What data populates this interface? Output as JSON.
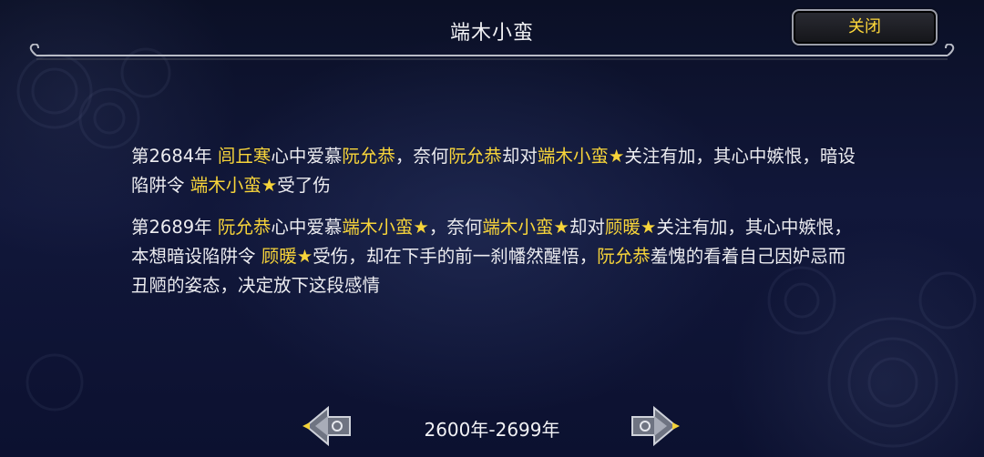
{
  "header": {
    "title": "端木小蛮",
    "close_label": "关闭"
  },
  "events": [
    {
      "segments": [
        {
          "text": "第2684年 ",
          "hl": false
        },
        {
          "text": "闾丘寒",
          "hl": true
        },
        {
          "text": "心中爱慕",
          "hl": false
        },
        {
          "text": "阮允恭",
          "hl": true
        },
        {
          "text": "，奈何",
          "hl": false
        },
        {
          "text": "阮允恭",
          "hl": true
        },
        {
          "text": "却对",
          "hl": false
        },
        {
          "text": "端木小蛮★",
          "hl": true
        },
        {
          "text": "关注有加，其心中嫉恨，暗设陷阱令 ",
          "hl": false
        },
        {
          "text": "端木小蛮★",
          "hl": true
        },
        {
          "text": "受了伤",
          "hl": false
        }
      ]
    },
    {
      "segments": [
        {
          "text": "第2689年 ",
          "hl": false
        },
        {
          "text": "阮允恭",
          "hl": true
        },
        {
          "text": "心中爱慕",
          "hl": false
        },
        {
          "text": "端木小蛮★",
          "hl": true
        },
        {
          "text": "，奈何",
          "hl": false
        },
        {
          "text": "端木小蛮★",
          "hl": true
        },
        {
          "text": "却对",
          "hl": false
        },
        {
          "text": "顾暖★",
          "hl": true
        },
        {
          "text": "关注有加，其心中嫉恨，本想暗设陷阱令 ",
          "hl": false
        },
        {
          "text": "顾暖★",
          "hl": true
        },
        {
          "text": "受伤，却在下手的前一刹幡然醒悟，",
          "hl": false
        },
        {
          "text": "阮允恭",
          "hl": true
        },
        {
          "text": "羞愧的看着自己因妒忌而丑陋的姿态，决定放下这段感情",
          "hl": false
        }
      ]
    }
  ],
  "footer": {
    "range_label": "2600年-2699年"
  },
  "colors": {
    "highlight": "#f7d43a",
    "text": "#ececf0",
    "background": "#0f1535"
  },
  "icons": {
    "prev": "ornate-arrow-left-icon",
    "next": "ornate-arrow-right-icon"
  }
}
